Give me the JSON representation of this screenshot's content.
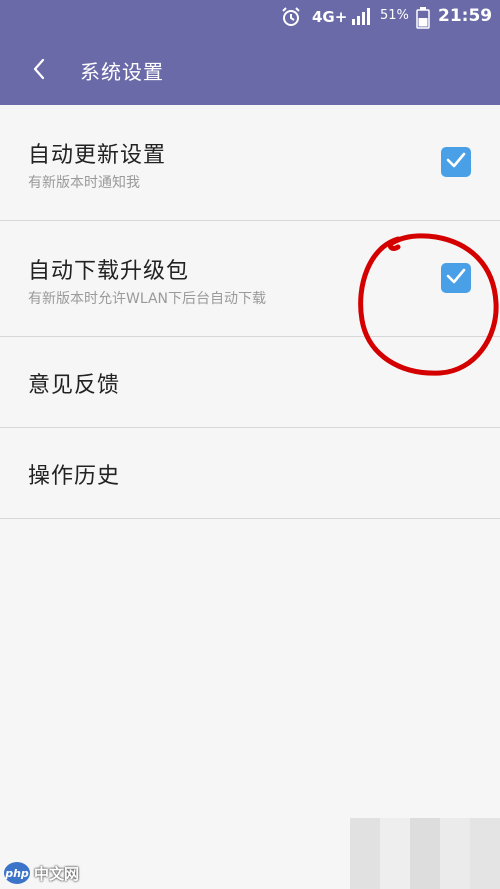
{
  "status_bar": {
    "network": "4G+",
    "battery_percent": "51%",
    "time": "21:59",
    "icons": [
      "alarm-icon",
      "signal-icon",
      "battery-icon"
    ]
  },
  "header": {
    "title": "系统设置",
    "back_icon": "chevron-left-icon"
  },
  "settings": {
    "items": [
      {
        "label": "自动更新设置",
        "description": "有新版本时通知我",
        "checked": true
      },
      {
        "label": "自动下载升级包",
        "description": "有新版本时允许WLAN下后台自动下载",
        "checked": true
      },
      {
        "label": "意见反馈"
      },
      {
        "label": "操作历史"
      }
    ]
  },
  "watermark": {
    "logo_text": "php",
    "text": "中文网"
  },
  "colors": {
    "header": "#6a6aa8",
    "checkbox": "#4aa0e6",
    "annotation": "#d40000",
    "background": "#f6f6f6"
  }
}
